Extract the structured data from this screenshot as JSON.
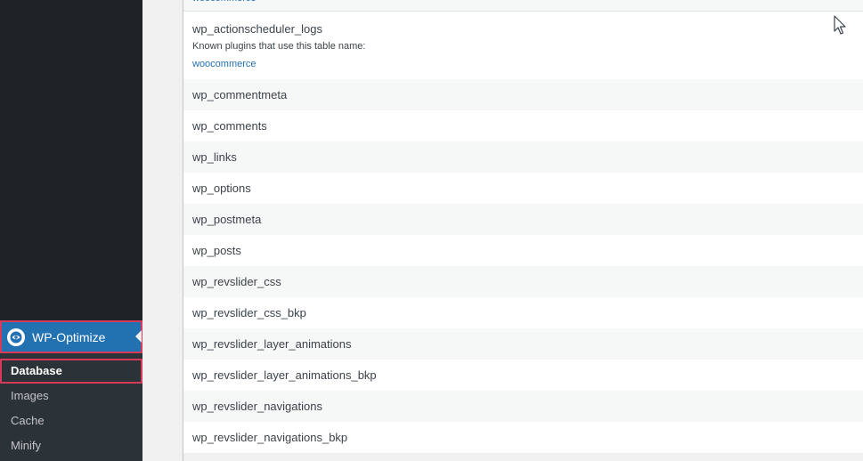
{
  "sidebar": {
    "active_menu": {
      "label": "WP-Optimize",
      "icon": "wp-optimize-icon"
    },
    "submenu": [
      {
        "label": "Database",
        "current": true
      },
      {
        "label": "Images",
        "current": false
      },
      {
        "label": "Cache",
        "current": false
      },
      {
        "label": "Minify",
        "current": false
      }
    ]
  },
  "tables": {
    "partial_row_link": "woocommerce",
    "expanded_row": {
      "name": "wp_actionscheduler_logs",
      "note": "Known plugins that use this table name:",
      "plugin": "woocommerce"
    },
    "rows": [
      "wp_commentmeta",
      "wp_comments",
      "wp_links",
      "wp_options",
      "wp_postmeta",
      "wp_posts",
      "wp_revslider_css",
      "wp_revslider_css_bkp",
      "wp_revslider_layer_animations",
      "wp_revslider_layer_animations_bkp",
      "wp_revslider_navigations",
      "wp_revslider_navigations_bkp"
    ]
  },
  "colors": {
    "sidebar_bg": "#1d2327",
    "submenu_bg": "#2c3338",
    "active_menu_bg": "#2271b1",
    "highlight_outline": "#d63a5a",
    "link": "#2271b1"
  }
}
